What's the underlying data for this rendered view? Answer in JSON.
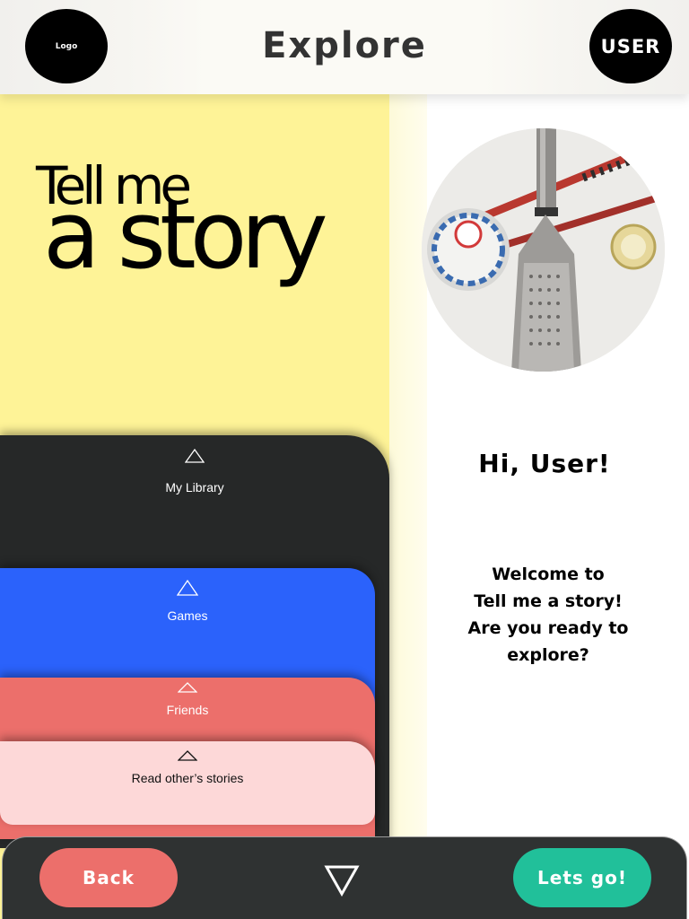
{
  "header": {
    "logo_label": "Logo",
    "title": "Explore",
    "user_label": "USER"
  },
  "hero": {
    "line1": "Tell me",
    "line2": "a story"
  },
  "greeting": "Hi, User!",
  "welcome": {
    "line1": "Welcome to",
    "line2": "Tell me a story!",
    "line3": "Are you ready to explore?"
  },
  "menu": {
    "items": [
      {
        "label": "My Library",
        "color": "#262828",
        "icon": "triangle-up-icon"
      },
      {
        "label": "Games",
        "color": "#2b62fb",
        "icon": "triangle-up-icon"
      },
      {
        "label": "Friends",
        "color": "#ec6f6b",
        "icon": "triangle-up-icon"
      },
      {
        "label": "Read other’s stories",
        "color": "#fdd8d8",
        "icon": "triangle-up-icon"
      }
    ]
  },
  "footer": {
    "back_label": "Back",
    "go_label": "Lets go!",
    "down_icon": "triangle-down-icon"
  },
  "colors": {
    "yellow": "#fef397",
    "back": "#ec6f6b",
    "go": "#21c09a",
    "bar": "#2f3232"
  }
}
